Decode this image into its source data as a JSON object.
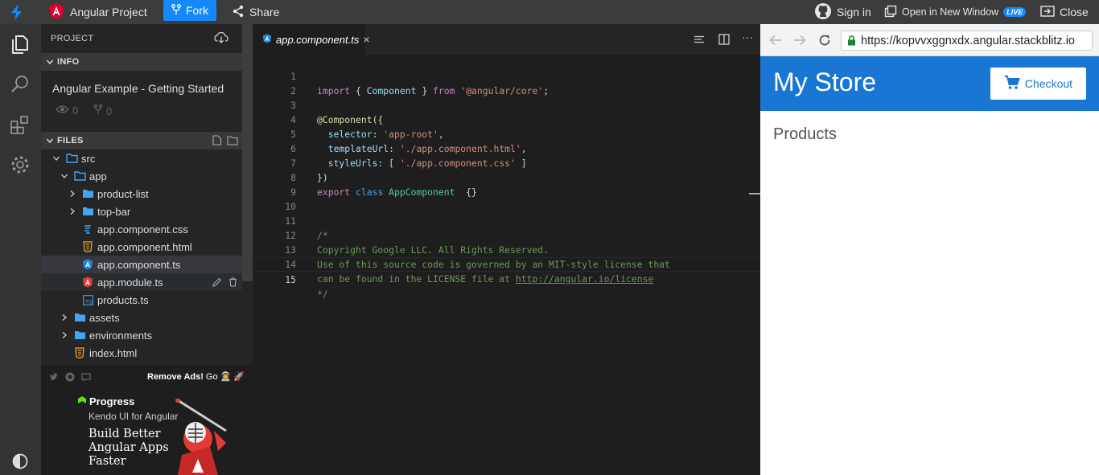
{
  "topbar": {
    "project_name": "Angular Project",
    "fork_label": "Fork",
    "share_label": "Share",
    "signin_label": "Sign in",
    "open_new_window_label": "Open in New Window",
    "live_badge": "LIVE",
    "close_label": "Close"
  },
  "sidebar": {
    "project_header": "PROJECT",
    "info_header": "INFO",
    "project_title": "Angular Example - Getting Started",
    "views_count": "0",
    "forks_count": "0",
    "files_header": "FILES",
    "tree": [
      {
        "name": "src",
        "type": "folder-open"
      },
      {
        "name": "app",
        "type": "folder-open"
      },
      {
        "name": "product-list",
        "type": "folder"
      },
      {
        "name": "top-bar",
        "type": "folder"
      },
      {
        "name": "app.component.css",
        "type": "css"
      },
      {
        "name": "app.component.html",
        "type": "html"
      },
      {
        "name": "app.component.ts",
        "type": "angular"
      },
      {
        "name": "app.module.ts",
        "type": "angular-red"
      },
      {
        "name": "products.ts",
        "type": "ts"
      },
      {
        "name": "assets",
        "type": "folder"
      },
      {
        "name": "environments",
        "type": "folder"
      },
      {
        "name": "index.html",
        "type": "html"
      }
    ],
    "ad": {
      "remove_ads": "Remove Ads!",
      "go": "Go",
      "brand": "Progress",
      "product": "Kendo UI for Angular",
      "headline_1": "Build Better",
      "headline_2": "Angular Apps",
      "headline_3": "Faster"
    }
  },
  "editor": {
    "tab_name": "app.component.ts",
    "tab_close": "×",
    "line_numbers": [
      "1",
      "2",
      "3",
      "4",
      "5",
      "6",
      "7",
      "8",
      "9",
      "10",
      "11",
      "12",
      "13",
      "14",
      "15"
    ],
    "code": {
      "l1_import": "import",
      "l1_open": " { ",
      "l1_component": "Component",
      "l1_close": " } ",
      "l1_from": "from",
      "l1_module": " '@angular/core'",
      "l1_semi": ";",
      "l3": "@Component({",
      "l4_key": "  selector",
      "l4_val": " 'app-root'",
      "l5_key": "  templateUrl",
      "l5_val": " './app.component.html'",
      "l6_key": "  styleUrls",
      "l6_open": " [ ",
      "l6_val": "'./app.component.css'",
      "l6_close": " ]",
      "l7": "})",
      "l8_export": "export",
      "l8_class": " class ",
      "l8_name": "AppComponent",
      "l8_body": "  {}",
      "l11": "/*",
      "l12": "Copyright Google LLC. All Rights Reserved.",
      "l13": "Use of this source code is governed by an MIT-style license that",
      "l14_pre": "can be found in the LICENSE file at ",
      "l14_link": "http://angular.io/license",
      "l15": "*/"
    }
  },
  "browser": {
    "url": "https://kopvvxggnxdx.angular.stackblitz.io",
    "store_title": "My Store",
    "checkout_label": "Checkout",
    "products_heading": "Products"
  },
  "colors": {
    "accent": "#1389fd",
    "store_blue": "#1976d2",
    "editor_bg": "#1e1e1e",
    "sidebar_bg": "#252526"
  }
}
